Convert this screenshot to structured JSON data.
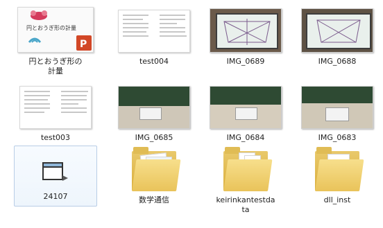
{
  "files": [
    {
      "name": "円とおうぎ形の計量",
      "label_line1": "円とおうぎ形の",
      "label_line2": "計量",
      "type": "powerpoint",
      "thumb_title": "円とおうぎ形の計量"
    },
    {
      "name": "test004",
      "type": "document"
    },
    {
      "name": "IMG_0689",
      "type": "photo"
    },
    {
      "name": "IMG_0688",
      "type": "photo"
    },
    {
      "name": "test003",
      "type": "document"
    },
    {
      "name": "IMG_0685",
      "type": "photo"
    },
    {
      "name": "IMG_0684",
      "type": "photo"
    },
    {
      "name": "IMG_0683",
      "type": "photo"
    },
    {
      "name": "24107",
      "type": "application"
    },
    {
      "name": "数学通信",
      "type": "folder"
    },
    {
      "name": "keirinkantestdata",
      "label_line1": "keirinkantestda",
      "label_line2": "ta",
      "type": "folder"
    },
    {
      "name": "dll_inst",
      "type": "folder"
    }
  ],
  "colors": {
    "selection_border": "#b8cde6",
    "folder": "#e9c35a",
    "powerpoint": "#d24726"
  },
  "icons": [
    "powerpoint-icon",
    "document-icon",
    "photo-icon",
    "application-icon",
    "folder-icon"
  ]
}
